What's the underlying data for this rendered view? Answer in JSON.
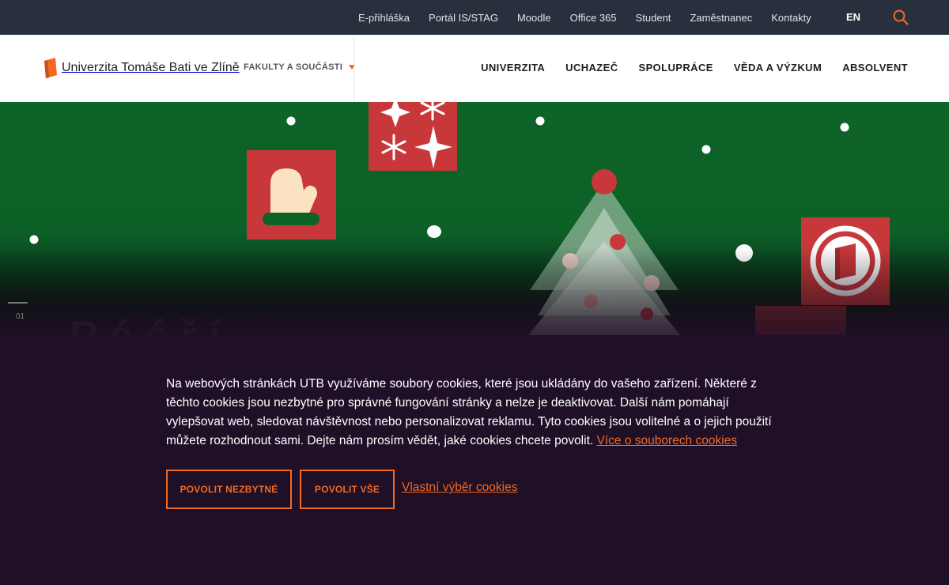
{
  "topbar": {
    "links": [
      "E-přihláška",
      "Portál IS/STAG",
      "Moodle",
      "Office 365",
      "Student",
      "Zaměstnanec",
      "Kontakty"
    ],
    "lang": "EN",
    "search_icon": "search-icon"
  },
  "header": {
    "logo_text": "Univerzita Tomáše Bati ve Zlíně",
    "faculties_label": "FAKULTY A SOUČÁSTI",
    "nav": [
      "UNIVERZITA",
      "UCHAZEČ",
      "SPOLUPRÁCE",
      "VĚDA A VÝZKUM",
      "ABSOLVENT"
    ]
  },
  "hero": {
    "slide_number": "01",
    "colors": {
      "green": "#0e6328",
      "red": "#c8383a",
      "accent": "#f26a21"
    }
  },
  "cookie": {
    "text": "Na webových stránkách UTB využíváme soubory cookies, které jsou ukládány do vašeho zařízení. Některé z těchto cookies jsou nezbytné pro správné fungování stránky a nelze je deaktivovat. Další nám pomáhají vylepšovat web, sledovat návštěvnost nebo personalizovat reklamu. Tyto cookies jsou volitelné a o jejich použití můžete rozhodnout sami. Dejte nám prosím vědět, jaké cookies chcete povolit.",
    "more_link": "Více o souborech cookies",
    "btn_necessary": "POVOLIT NEZBYTNÉ",
    "btn_all": "POVOLIT VŠE",
    "custom_link": "Vlastní výběr cookies"
  }
}
